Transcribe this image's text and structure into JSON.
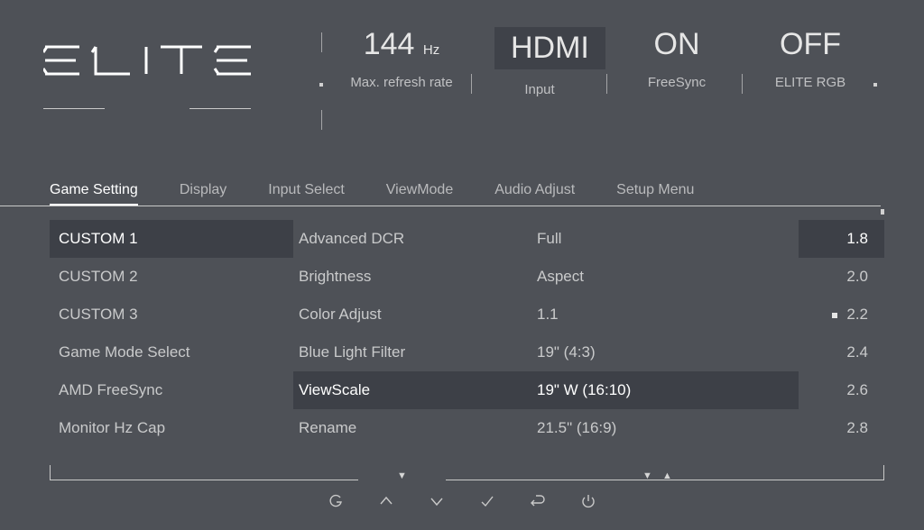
{
  "header": {
    "refresh_value": "144",
    "refresh_unit": "Hz",
    "refresh_label": "Max. refresh rate",
    "input_value": "HDMI",
    "input_label": "Input",
    "freesync_value": "ON",
    "freesync_label": "FreeSync",
    "rgb_value": "OFF",
    "rgb_label": "ELITE RGB"
  },
  "tabs": {
    "items": [
      "Game Setting",
      "Display",
      "Input Select",
      "ViewMode",
      "Audio Adjust",
      "Setup Menu"
    ],
    "active_index": 0
  },
  "col1": [
    "CUSTOM 1",
    "CUSTOM 2",
    "CUSTOM 3",
    "Game Mode Select",
    "AMD FreeSync",
    "Monitor Hz Cap"
  ],
  "col1_selected": 0,
  "col2": [
    "Advanced DCR",
    "Brightness",
    "Color Adjust",
    "Blue Light Filter",
    "ViewScale",
    "Rename"
  ],
  "col2_selected": 4,
  "col3": [
    "Full",
    "Aspect",
    "1.1",
    "19\" (4:3)",
    "19\" W (16:10)",
    "21.5\" (16:9)"
  ],
  "col3_selected": 4,
  "col4": [
    "1.8",
    "2.0",
    "2.2",
    "2.4",
    "2.6",
    "2.8"
  ],
  "col4_selected": 0,
  "col4_marker": 2
}
